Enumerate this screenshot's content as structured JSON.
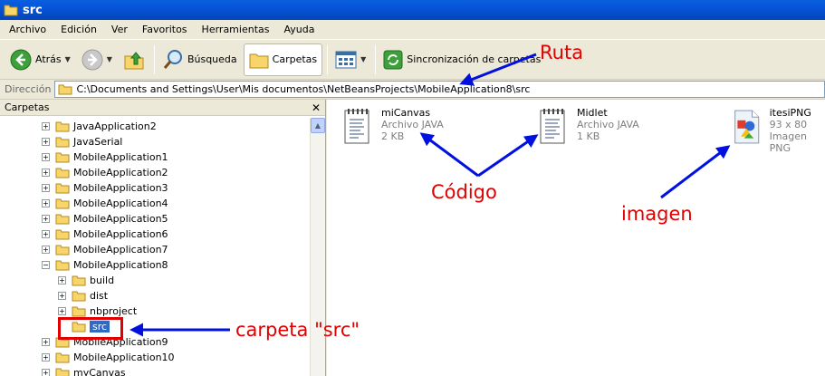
{
  "window": {
    "title": "src"
  },
  "menu": [
    "Archivo",
    "Edición",
    "Ver",
    "Favoritos",
    "Herramientas",
    "Ayuda"
  ],
  "toolbar": {
    "back_label": "Atrás",
    "search_label": "Búsqueda",
    "folders_label": "Carpetas",
    "sync_label": "Sincronización de carpetas"
  },
  "address": {
    "label": "Dirección",
    "path": "C:\\Documents and Settings\\User\\Mis documentos\\NetBeansProjects\\MobileApplication8\\src"
  },
  "folders_panel": {
    "title": "Carpetas",
    "items": [
      {
        "label": "JavaApplication2",
        "expander": "+"
      },
      {
        "label": "JavaSerial",
        "expander": "+"
      },
      {
        "label": "MobileApplication1",
        "expander": "+"
      },
      {
        "label": "MobileApplication2",
        "expander": "+"
      },
      {
        "label": "MobileApplication3",
        "expander": "+"
      },
      {
        "label": "MobileApplication4",
        "expander": "+"
      },
      {
        "label": "MobileApplication5",
        "expander": "+"
      },
      {
        "label": "MobileApplication6",
        "expander": "+"
      },
      {
        "label": "MobileApplication7",
        "expander": "+"
      },
      {
        "label": "MobileApplication8",
        "expander": "−"
      },
      {
        "label": "build",
        "expander": "+"
      },
      {
        "label": "dist",
        "expander": "+"
      },
      {
        "label": "nbproject",
        "expander": "+"
      },
      {
        "label": "src",
        "expander": ""
      },
      {
        "label": "MobileApplication9",
        "expander": "+"
      },
      {
        "label": "MobileApplication10",
        "expander": "+"
      },
      {
        "label": "myCanvas",
        "expander": "+"
      }
    ]
  },
  "files": [
    {
      "name": "miCanvas",
      "type": "Archivo JAVA",
      "size": "2 KB"
    },
    {
      "name": "Midlet",
      "type": "Archivo JAVA",
      "size": "1 KB"
    },
    {
      "name": "itesiPNG",
      "dims": "93 x 80",
      "type": "Imagen PNG"
    }
  ],
  "annotations": {
    "ruta": "Ruta",
    "codigo": "Código",
    "imagen": "imagen",
    "carpeta": "carpeta \"src\""
  },
  "colors": {
    "titlebar": "#0554D8",
    "selection": "#316AC5",
    "annotation": "#E20000",
    "arrow": "#0010E0"
  }
}
